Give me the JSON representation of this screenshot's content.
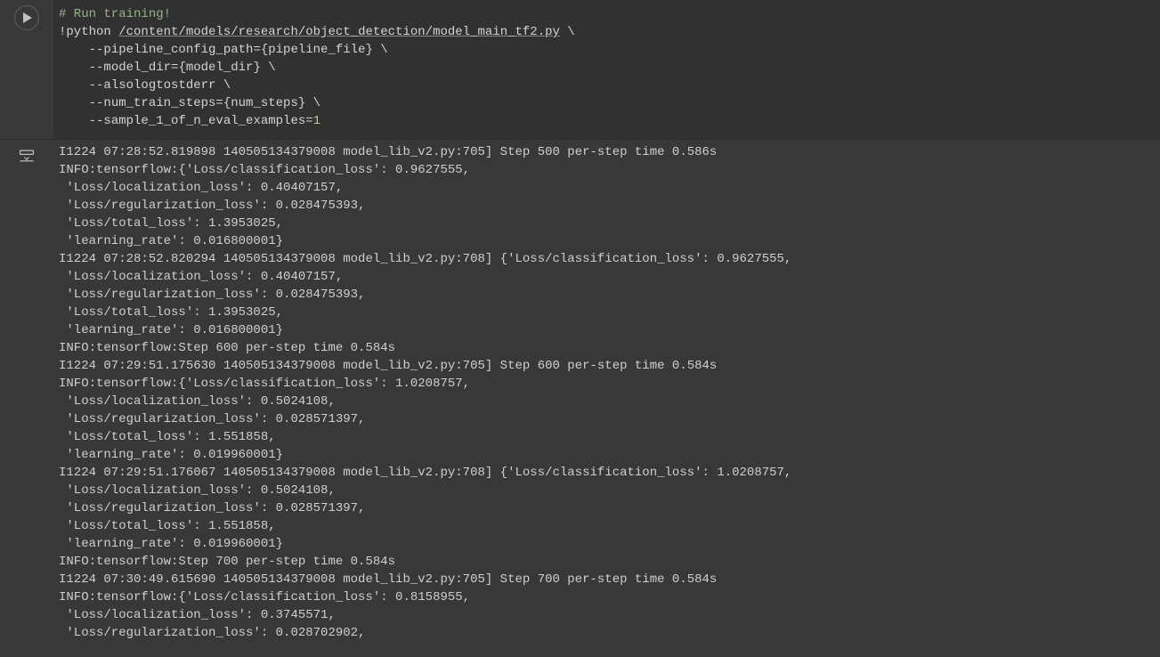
{
  "code": {
    "comment": "# Run training!",
    "line1_prefix": "!python ",
    "line1_path": "/content/models/research/object_detection/model_main_tf2.py",
    "line1_suffix": " \\",
    "indent": "    ",
    "line2_a": "--pipeline_config_path=",
    "line2_b": "{",
    "line2_c": "pipeline_file",
    "line2_d": "}",
    "line2_e": " \\",
    "line3_a": "--model_dir=",
    "line3_b": "{",
    "line3_c": "model_dir",
    "line3_d": "}",
    "line3_e": " \\",
    "line4_a": "--alsologtostderr \\",
    "line5_a": "--num_train_steps=",
    "line5_b": "{",
    "line5_c": "num_steps",
    "line5_d": "}",
    "line5_e": " \\",
    "line6_a": "--sample_1_of_n_eval_examples=",
    "line6_num": "1"
  },
  "output": {
    "lines": [
      "I1224 07:28:52.819898 140505134379008 model_lib_v2.py:705] Step 500 per-step time 0.586s",
      "INFO:tensorflow:{'Loss/classification_loss': 0.9627555,",
      " 'Loss/localization_loss': 0.40407157,",
      " 'Loss/regularization_loss': 0.028475393,",
      " 'Loss/total_loss': 1.3953025,",
      " 'learning_rate': 0.016800001}",
      "I1224 07:28:52.820294 140505134379008 model_lib_v2.py:708] {'Loss/classification_loss': 0.9627555,",
      " 'Loss/localization_loss': 0.40407157,",
      " 'Loss/regularization_loss': 0.028475393,",
      " 'Loss/total_loss': 1.3953025,",
      " 'learning_rate': 0.016800001}",
      "INFO:tensorflow:Step 600 per-step time 0.584s",
      "I1224 07:29:51.175630 140505134379008 model_lib_v2.py:705] Step 600 per-step time 0.584s",
      "INFO:tensorflow:{'Loss/classification_loss': 1.0208757,",
      " 'Loss/localization_loss': 0.5024108,",
      " 'Loss/regularization_loss': 0.028571397,",
      " 'Loss/total_loss': 1.551858,",
      " 'learning_rate': 0.019960001}",
      "I1224 07:29:51.176067 140505134379008 model_lib_v2.py:708] {'Loss/classification_loss': 1.0208757,",
      " 'Loss/localization_loss': 0.5024108,",
      " 'Loss/regularization_loss': 0.028571397,",
      " 'Loss/total_loss': 1.551858,",
      " 'learning_rate': 0.019960001}",
      "INFO:tensorflow:Step 700 per-step time 0.584s",
      "I1224 07:30:49.615690 140505134379008 model_lib_v2.py:705] Step 700 per-step time 0.584s",
      "INFO:tensorflow:{'Loss/classification_loss': 0.8158955,",
      " 'Loss/localization_loss': 0.3745571,",
      " 'Loss/regularization_loss': 0.028702902,"
    ]
  }
}
